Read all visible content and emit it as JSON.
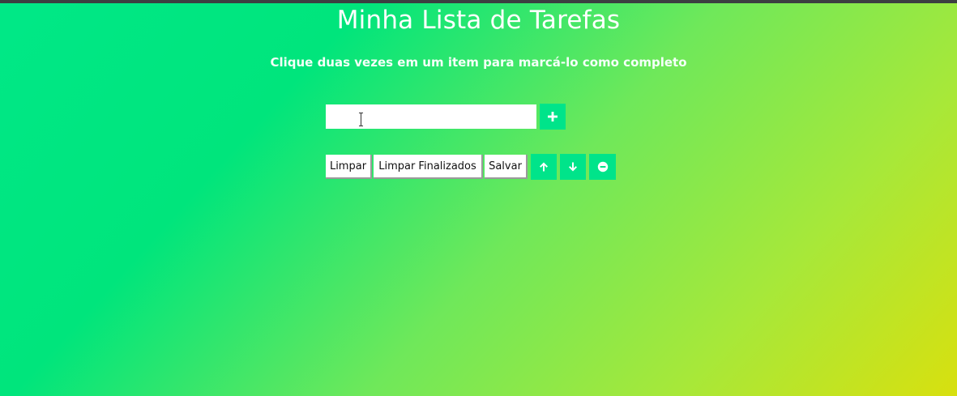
{
  "header": {
    "title": "Minha Lista de Tarefas",
    "subtitle": "Clique duas vezes em um item para marcá-lo como completo"
  },
  "task_entry": {
    "value": "",
    "add_icon": "plus-icon"
  },
  "actions": {
    "clear_label": "Limpar",
    "clear_done_label": "Limpar Finalizados",
    "save_label": "Salvar",
    "up_icon": "arrow-up-icon",
    "down_icon": "arrow-down-icon",
    "remove_icon": "minus-circle-icon"
  },
  "colors": {
    "gradient_start": "#00e887",
    "gradient_end": "#d8e00f",
    "icon_button": "#00e48a",
    "text_white": "#ffffff"
  }
}
